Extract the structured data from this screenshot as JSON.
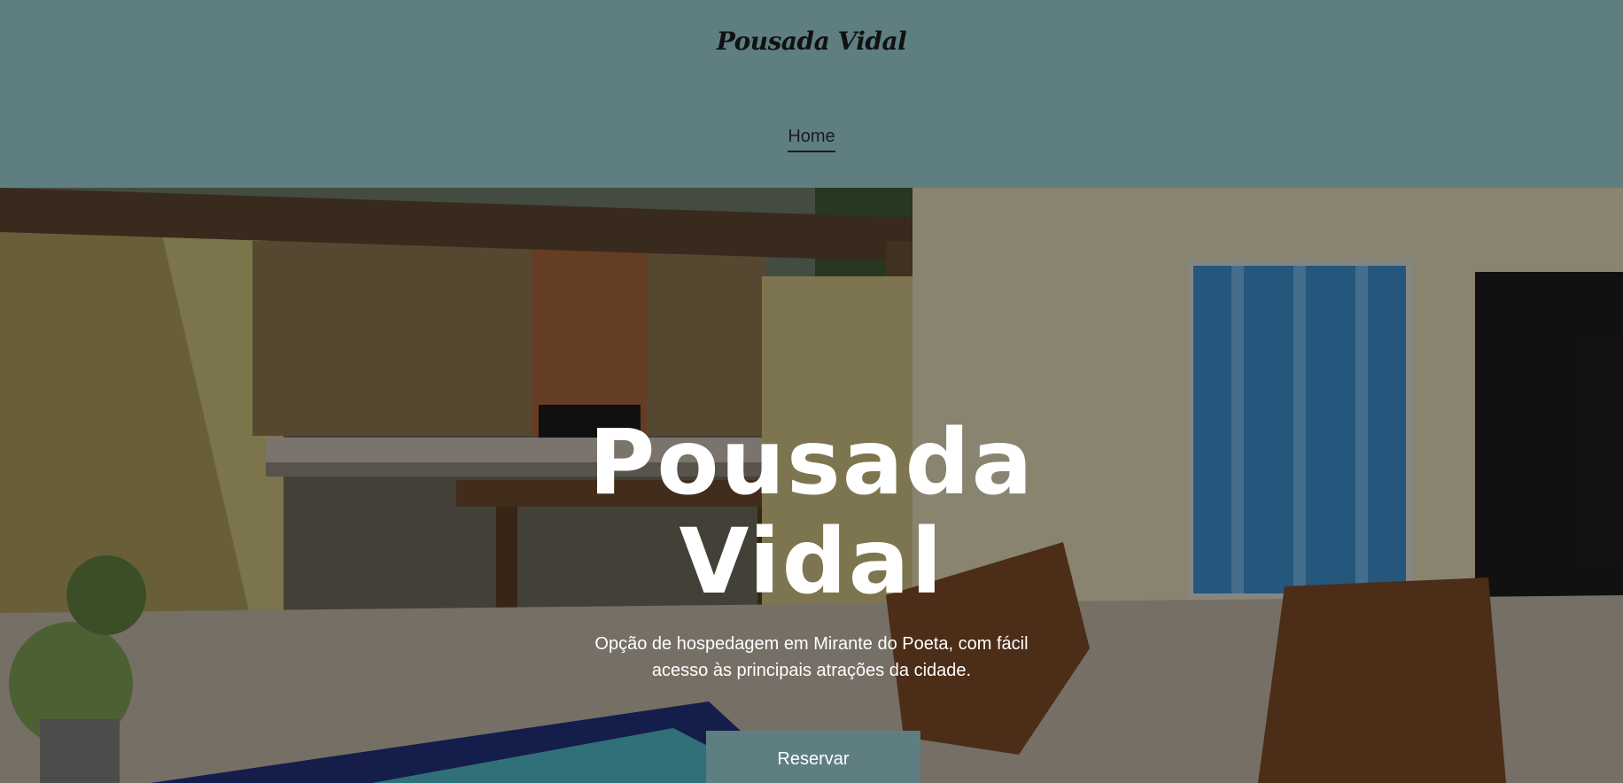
{
  "header": {
    "site_title": "Pousada Vidal",
    "nav": {
      "home_label": "Home"
    },
    "background_color": "#5e7e82"
  },
  "hero": {
    "title_line1": "Pousada",
    "title_line2": "Vidal",
    "subtitle_line1": "Opção de hospedagem em Mirante do Poeta, com fácil",
    "subtitle_line2": "acesso às principais atrações da cidade.",
    "reserve_label": "Reservar",
    "button_color": "#5e7e82"
  }
}
